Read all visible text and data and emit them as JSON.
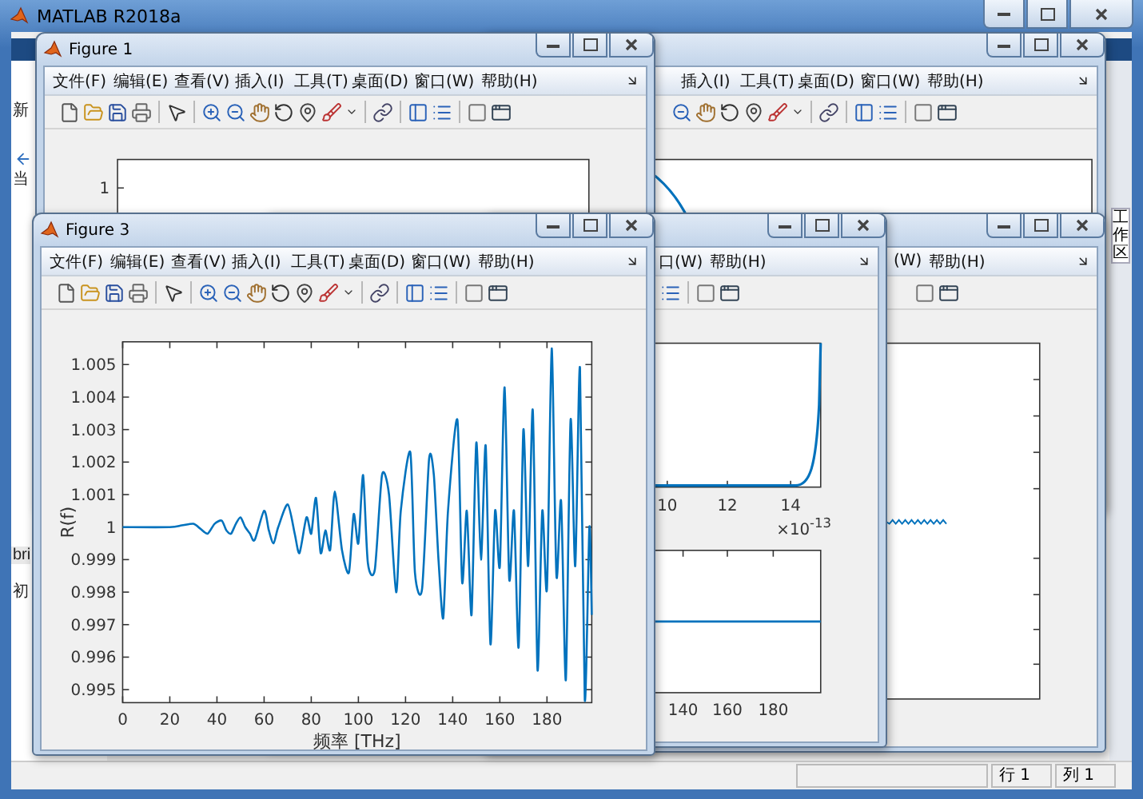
{
  "app_window": {
    "title": "MATLAB R2018a",
    "left_panel": [
      "新",
      "当",
      "bri",
      "初"
    ],
    "right_panel_label": "工作区",
    "status_bar": {
      "row": "行 1",
      "column": "列 1"
    }
  },
  "figure_windows": [
    {
      "kind": "back_right",
      "menu": [
        "插入(I)",
        "工具(T)",
        "桌面(D)",
        "窗口(W)",
        "帮助(H)"
      ]
    },
    {
      "kind": "figure1",
      "title": "Figure 1",
      "menu": [
        "文件(F)",
        "编辑(E)",
        "查看(V)",
        "插入(I)",
        "工具(T)",
        "桌面(D)",
        "窗口(W)",
        "帮助(H)"
      ],
      "y_ticks": [
        "1"
      ]
    },
    {
      "kind": "right",
      "menu": [
        "(W)",
        "帮助(H)"
      ]
    },
    {
      "kind": "middle",
      "menu": [
        "口(W)",
        "帮助(H)"
      ],
      "top_x_ticks": [
        "10",
        "12",
        "14"
      ],
      "exponent": "×10$^{-13}$",
      "bottom_x_ticks": [
        "140",
        "160",
        "180"
      ]
    },
    {
      "kind": "figure3",
      "title": "Figure 3",
      "menu": [
        "文件(F)",
        "编辑(E)",
        "查看(V)",
        "插入(I)",
        "工具(T)",
        "桌面(D)",
        "窗口(W)",
        "帮助(H)"
      ],
      "chart_data": {
        "type": "line",
        "xlabel": "频率 [THz]",
        "ylabel": "R(f)",
        "xlim": [
          0,
          199
        ],
        "ylim": [
          0.9946,
          1.0057
        ],
        "xticks": [
          0,
          20,
          40,
          60,
          80,
          100,
          120,
          140,
          160,
          180
        ],
        "yticks": [
          0.995,
          0.996,
          0.997,
          0.998,
          0.999,
          1,
          1.001,
          1.002,
          1.003,
          1.004,
          1.005
        ],
        "x": [
          0,
          20,
          25,
          30,
          33,
          36,
          39,
          42,
          44,
          46,
          48,
          50,
          52,
          54,
          56,
          60,
          62,
          64,
          66,
          70,
          73,
          75,
          78,
          80,
          82,
          84,
          86,
          88,
          90,
          93,
          96,
          98,
          100,
          102,
          104,
          107,
          110,
          113,
          116,
          118,
          122,
          124,
          127,
          130,
          132,
          134,
          136,
          138,
          142,
          144,
          146,
          148,
          150,
          152,
          154,
          156,
          158,
          160,
          162,
          164,
          166,
          168,
          170,
          172,
          174,
          176,
          178,
          180,
          182,
          184,
          186,
          188,
          190,
          192,
          194,
          196,
          198,
          199
        ],
        "values": [
          1,
          1,
          1.00005,
          1.0001,
          0.99995,
          0.9998,
          1.0001,
          1.0002,
          0.9999,
          0.9998,
          1.0001,
          1.0003,
          1.0,
          0.9998,
          0.9996,
          1.0005,
          0.9999,
          0.9995,
          1.0,
          1.0007,
          0.9998,
          0.9992,
          1.0003,
          0.9998,
          1.0009,
          0.9992,
          0.9999,
          0.9993,
          1.0011,
          0.9993,
          0.9986,
          1.0004,
          0.9995,
          1.0016,
          0.9989,
          0.9987,
          1.0016,
          1.001,
          0.998,
          1.0005,
          1.0023,
          0.9986,
          0.9981,
          1.0021,
          1.0016,
          0.999,
          0.9972,
          1.0005,
          1.0033,
          0.9983,
          1.0005,
          0.9973,
          1.0026,
          0.999,
          1.0025,
          0.9964,
          1.0005,
          0.9988,
          1.0043,
          0.9984,
          1.0005,
          0.9963,
          1.003,
          0.9988,
          1.0036,
          0.9956,
          1.0005,
          0.9981,
          1.0055,
          0.9985,
          1.0008,
          0.9953,
          1.0033,
          0.9988,
          1.0049,
          0.9947,
          1.0,
          0.9973
        ]
      }
    }
  ]
}
